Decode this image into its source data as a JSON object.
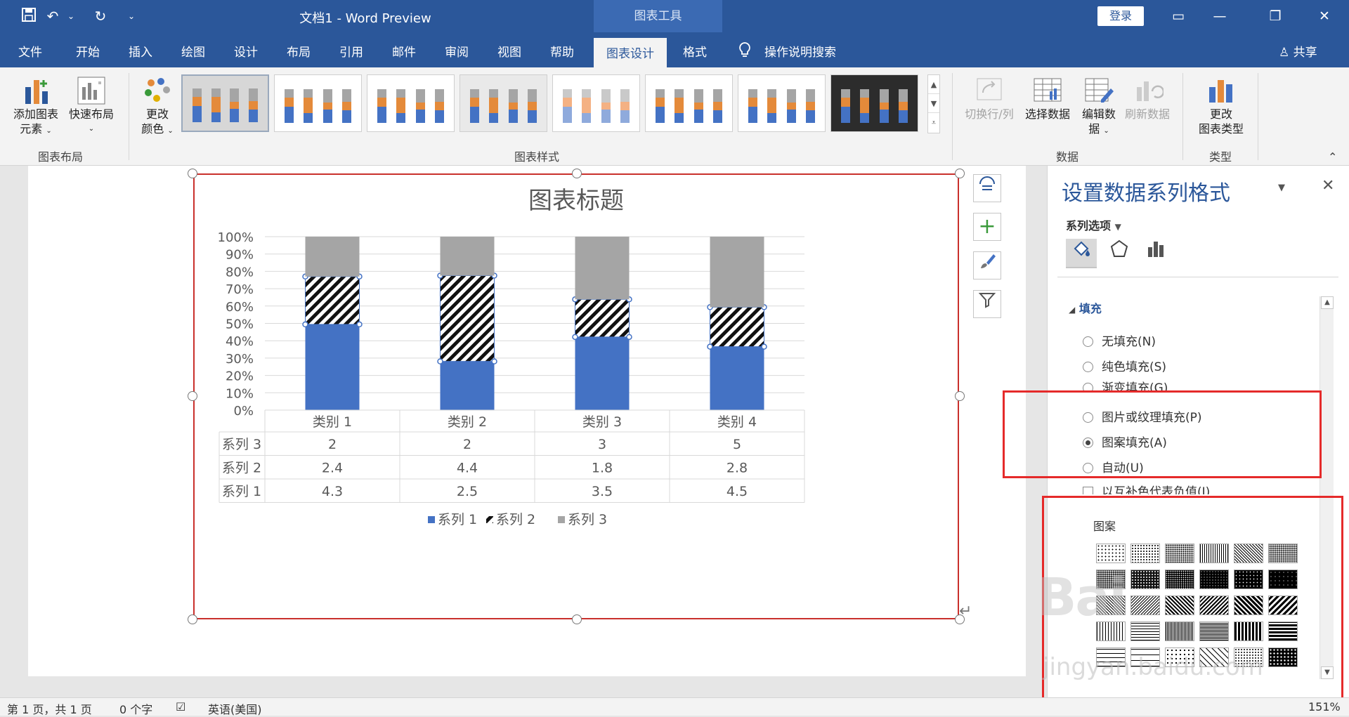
{
  "titlebar": {
    "doc_title": "文档1  -  Word Preview",
    "tool_tab_header": "图表工具",
    "login_label": "登录",
    "icons": [
      "save-icon",
      "undo-icon",
      "redo-icon",
      "customize-icon"
    ]
  },
  "menubar": {
    "items": [
      "文件",
      "开始",
      "插入",
      "绘图",
      "设计",
      "布局",
      "引用",
      "邮件",
      "审阅",
      "视图",
      "帮助",
      "图表设计",
      "格式"
    ],
    "active": "图表设计",
    "search_label": "操作说明搜索",
    "share_label": "共享"
  },
  "ribbon": {
    "add_element_line1": "添加图表",
    "add_element_line2": "元素",
    "quick_layout": "快速布局",
    "change_colors_line1": "更改",
    "change_colors_line2": "颜色",
    "group_layout": "图表布局",
    "group_styles": "图表样式",
    "switch_row_col": "切换行/列",
    "select_data": "选择数据",
    "edit_data_line1": "编辑数",
    "edit_data_line2": "据",
    "refresh_data": "刷新数据",
    "group_data": "数据",
    "change_type_line1": "更改",
    "change_type_line2": "图表类型",
    "group_type": "类型"
  },
  "chart_data": {
    "type": "bar",
    "stacked": "100%",
    "title": "图表标题",
    "categories": [
      "类别 1",
      "类别 2",
      "类别 3",
      "类别 4"
    ],
    "series": [
      {
        "name": "系列 1",
        "values": [
          4.3,
          2.5,
          3.5,
          4.5
        ],
        "color": "#4472c4",
        "fill": "solid"
      },
      {
        "name": "系列 2",
        "values": [
          2.4,
          4.4,
          1.8,
          2.8
        ],
        "color": "#000000",
        "fill": "diagonal-stripes"
      },
      {
        "name": "系列 3",
        "values": [
          2,
          2,
          3,
          5
        ],
        "color": "#a5a5a5",
        "fill": "solid"
      }
    ],
    "y_ticks": [
      "100%",
      "90%",
      "80%",
      "70%",
      "60%",
      "50%",
      "40%",
      "30%",
      "20%",
      "10%",
      "0%"
    ],
    "ylim": [
      0,
      1
    ],
    "grid": true,
    "legend": "bottom",
    "data_table": true,
    "table_rows_order": [
      "系列 3",
      "系列 2",
      "系列 1"
    ],
    "table_cells": [
      [
        "2",
        "2",
        "3",
        "5"
      ],
      [
        "2.4",
        "4.4",
        "1.8",
        "2.8"
      ],
      [
        "4.3",
        "2.5",
        "3.5",
        "4.5"
      ]
    ]
  },
  "pane": {
    "title": "设置数据系列格式",
    "series_options": "系列选项",
    "fill_section": "填充",
    "fill_options": [
      {
        "label": "无填充(N)",
        "checked": false
      },
      {
        "label": "纯色填充(S)",
        "checked": false
      },
      {
        "label": "渐变填充(G)",
        "checked": false
      },
      {
        "label": "图片或纹理填充(P)",
        "checked": false
      },
      {
        "label": "图案填充(A)",
        "checked": true
      },
      {
        "label": "自动(U)",
        "checked": false
      }
    ],
    "invert_label": "以互补色代表负值(I)",
    "pattern_label": "图案"
  },
  "statusbar": {
    "page": "第 1 页，共 1 页",
    "words": "0 个字",
    "language": "英语(美国)",
    "zoom": "151%"
  },
  "watermark": {
    "line1": "Bai",
    "line2": "jingyan.baidu.com"
  }
}
